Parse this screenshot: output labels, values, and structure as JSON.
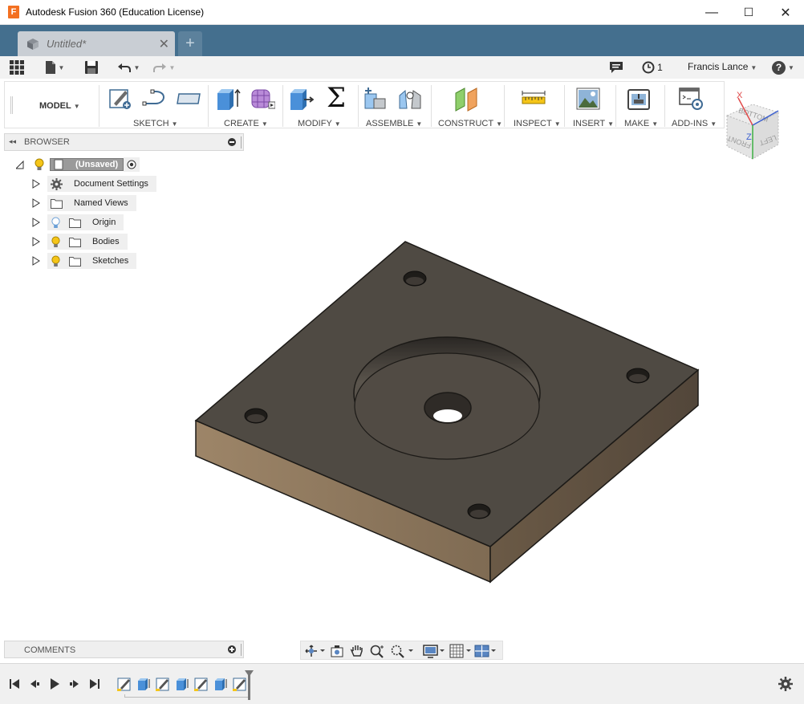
{
  "window": {
    "title": "Autodesk Fusion 360 (Education License)",
    "app_icon_letter": "F",
    "minimize": "—",
    "maximize": "☐",
    "close": "✕"
  },
  "tabs": {
    "document_title": "Untitled*",
    "close_glyph": "✕",
    "new_tab_glyph": "+"
  },
  "quick_access": {
    "job_count": "1",
    "user_name": "Francis Lance",
    "help_glyph": "?"
  },
  "ribbon": {
    "workspace": "MODEL",
    "groups": [
      "SKETCH",
      "CREATE",
      "MODIFY",
      "ASSEMBLE",
      "CONSTRUCT",
      "INSPECT",
      "INSERT",
      "MAKE",
      "ADD-INS"
    ],
    "sigma_glyph": "Σ"
  },
  "viewcube": {
    "faces": [
      "BOTTOM",
      "FRONT",
      "LEFT"
    ],
    "axis_x": "X",
    "axis_z": "Z"
  },
  "browser": {
    "title": "BROWSER",
    "collapse_glyph": "◂◂",
    "root_label": "(Unsaved)",
    "items": [
      {
        "label": "Document Settings"
      },
      {
        "label": "Named Views"
      },
      {
        "label": "Origin"
      },
      {
        "label": "Bodies"
      },
      {
        "label": "Sketches"
      }
    ]
  },
  "comments": {
    "title": "COMMENTS"
  },
  "colors": {
    "tab_bar": "#446f8e",
    "model_top": "#4f4a43",
    "model_side_light": "#9b8467",
    "model_side_dark": "#5f5140",
    "bulb_on": "#f5c518",
    "bulb_off": "#88b4e0"
  }
}
